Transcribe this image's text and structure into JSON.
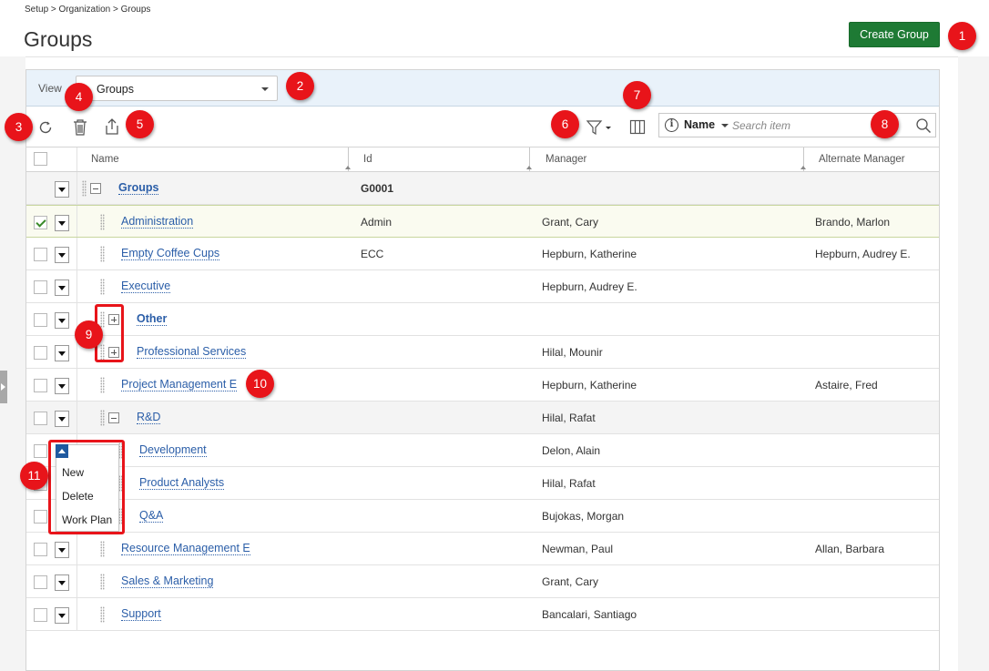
{
  "breadcrumb": "Setup > Organization > Groups",
  "page_title": "Groups",
  "create_button": "Create Group",
  "view": {
    "label": "View",
    "selected": "Groups"
  },
  "search": {
    "field": "Name",
    "placeholder": "Search item"
  },
  "columns": {
    "name": "Name",
    "id": "Id",
    "manager": "Manager",
    "alternate_manager": "Alternate Manager"
  },
  "rows": [
    {
      "name": "Groups",
      "id": "G0001",
      "manager": "",
      "alt": ""
    },
    {
      "name": "Administration",
      "id": "Admin",
      "manager": "Grant, Cary",
      "alt": "Brando, Marlon"
    },
    {
      "name": "Empty Coffee Cups",
      "id": "ECC",
      "manager": "Hepburn, Katherine",
      "alt": "Hepburn, Audrey E."
    },
    {
      "name": "Executive",
      "id": "",
      "manager": "Hepburn, Audrey E.",
      "alt": ""
    },
    {
      "name": "Other",
      "id": "",
      "manager": "",
      "alt": ""
    },
    {
      "name": "Professional Services",
      "id": "",
      "manager": "Hilal, Mounir",
      "alt": ""
    },
    {
      "name": "Project Management E",
      "id": "",
      "manager": "Hepburn, Katherine",
      "alt": "Astaire, Fred"
    },
    {
      "name": "R&D",
      "id": "",
      "manager": "Hilal, Rafat",
      "alt": ""
    },
    {
      "name": "Development",
      "id": "",
      "manager": "Delon, Alain",
      "alt": ""
    },
    {
      "name": "Product Analysts",
      "id": "",
      "manager": "Hilal, Rafat",
      "alt": ""
    },
    {
      "name": "Q&A",
      "id": "",
      "manager": "Bujokas, Morgan",
      "alt": ""
    },
    {
      "name": "Resource Management E",
      "id": "",
      "manager": "Newman, Paul",
      "alt": "Allan, Barbara"
    },
    {
      "name": "Sales & Marketing",
      "id": "",
      "manager": "Grant, Cary",
      "alt": ""
    },
    {
      "name": "Support",
      "id": "",
      "manager": "Bancalari, Santiago",
      "alt": ""
    }
  ],
  "row_menu": [
    "New",
    "Delete",
    "Work Plan"
  ],
  "callouts": [
    "1",
    "2",
    "3",
    "4",
    "5",
    "6",
    "7",
    "8",
    "9",
    "10",
    "11"
  ],
  "colors": {
    "accent": "#1e7a34",
    "link": "#2b5ea8",
    "callout": "#e8141a",
    "menu_toggle": "#1f5aa0"
  },
  "icons": [
    "refresh-icon",
    "trash-icon",
    "export-icon",
    "filter-icon",
    "columns-icon",
    "info-icon",
    "search-icon",
    "expand-icon",
    "collapse-icon",
    "chevron-down-icon"
  ]
}
